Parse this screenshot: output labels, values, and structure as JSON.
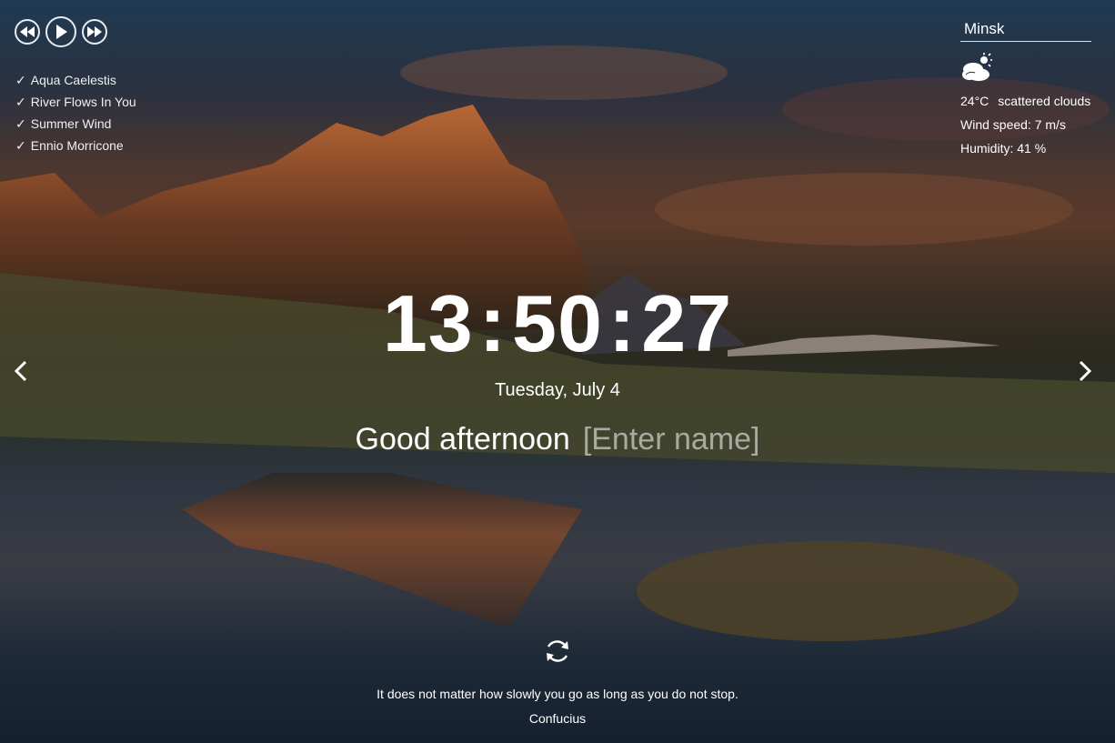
{
  "player": {
    "prev_icon": "rewind-icon",
    "play_icon": "play-icon",
    "next_icon": "fast-forward-icon"
  },
  "playlist": [
    {
      "title": "Aqua Caelestis"
    },
    {
      "title": "River Flows In You"
    },
    {
      "title": "Summer Wind"
    },
    {
      "title": "Ennio Morricone"
    }
  ],
  "weather": {
    "city": "Minsk",
    "icon": "scattered-clouds-icon",
    "temperature": "24°C",
    "description": "scattered clouds",
    "wind": "Wind speed: 7 m/s",
    "humidity": "Humidity: 41 %"
  },
  "clock": {
    "hours": "13",
    "minutes": "50",
    "seconds": "27",
    "separator": ":"
  },
  "date": "Tuesday, July 4",
  "greeting": {
    "text": "Good afternoon",
    "name_placeholder": "[Enter name]"
  },
  "quote": {
    "text": "It does not matter how slowly you go as long as you do not stop.",
    "author": "Confucius"
  },
  "colors": {
    "text": "#ffffff",
    "placeholder": "#b0b0b0"
  }
}
